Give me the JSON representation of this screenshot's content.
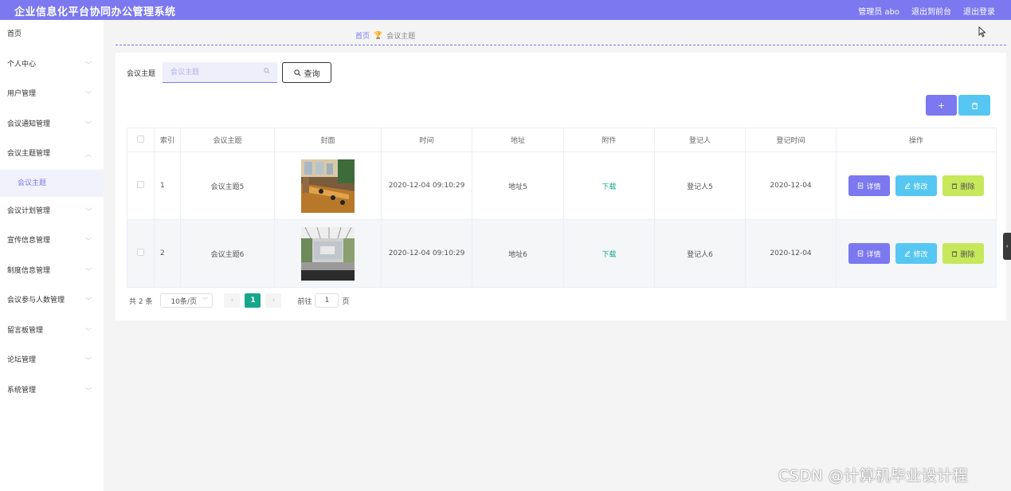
{
  "header": {
    "title": "企业信息化平台协同办公管理系统",
    "user": "管理员 abo",
    "to_front": "退出到前台",
    "logout": "退出登录"
  },
  "sidebar": {
    "items": [
      {
        "label": "首页"
      },
      {
        "label": "个人中心"
      },
      {
        "label": "用户管理"
      },
      {
        "label": "会议通知管理"
      },
      {
        "label": "会议主题管理"
      },
      {
        "label": "会议计划管理"
      },
      {
        "label": "宣传信息管理"
      },
      {
        "label": "制度信息管理"
      },
      {
        "label": "会议参与人数管理"
      },
      {
        "label": "留言板管理"
      },
      {
        "label": "论坛管理"
      },
      {
        "label": "系统管理"
      }
    ],
    "active_sub": "会议主题"
  },
  "breadcrumb": {
    "home": "首页",
    "current": "会议主题"
  },
  "search": {
    "label": "会议主题",
    "placeholder": "会议主题",
    "button": "查询"
  },
  "table": {
    "headers": [
      "索引",
      "会议主题",
      "封面",
      "时间",
      "地址",
      "附件",
      "登记人",
      "登记时间",
      "操作"
    ],
    "rows": [
      {
        "index": "1",
        "topic": "会议主题5",
        "time": "2020-12-04 09:10:29",
        "address": "地址5",
        "attachment": "下载",
        "registrant": "登记人5",
        "reg_time": "2020-12-04"
      },
      {
        "index": "2",
        "topic": "会议主题6",
        "time": "2020-12-04 09:10:29",
        "address": "地址6",
        "attachment": "下载",
        "registrant": "登记人6",
        "reg_time": "2020-12-04"
      }
    ],
    "actions": {
      "detail": "详情",
      "edit": "修改",
      "delete": "删除"
    }
  },
  "pagination": {
    "total": "共 2 条",
    "page_size": "10条/页",
    "current_page": "1",
    "goto_label": "前往",
    "goto_value": "1",
    "page_unit": "页"
  },
  "watermark": "CSDN @计算机毕业设计程",
  "colors": {
    "primary": "#7b78f0",
    "info": "#56c7f2",
    "warning": "#c6e85a",
    "success": "#16a689"
  }
}
